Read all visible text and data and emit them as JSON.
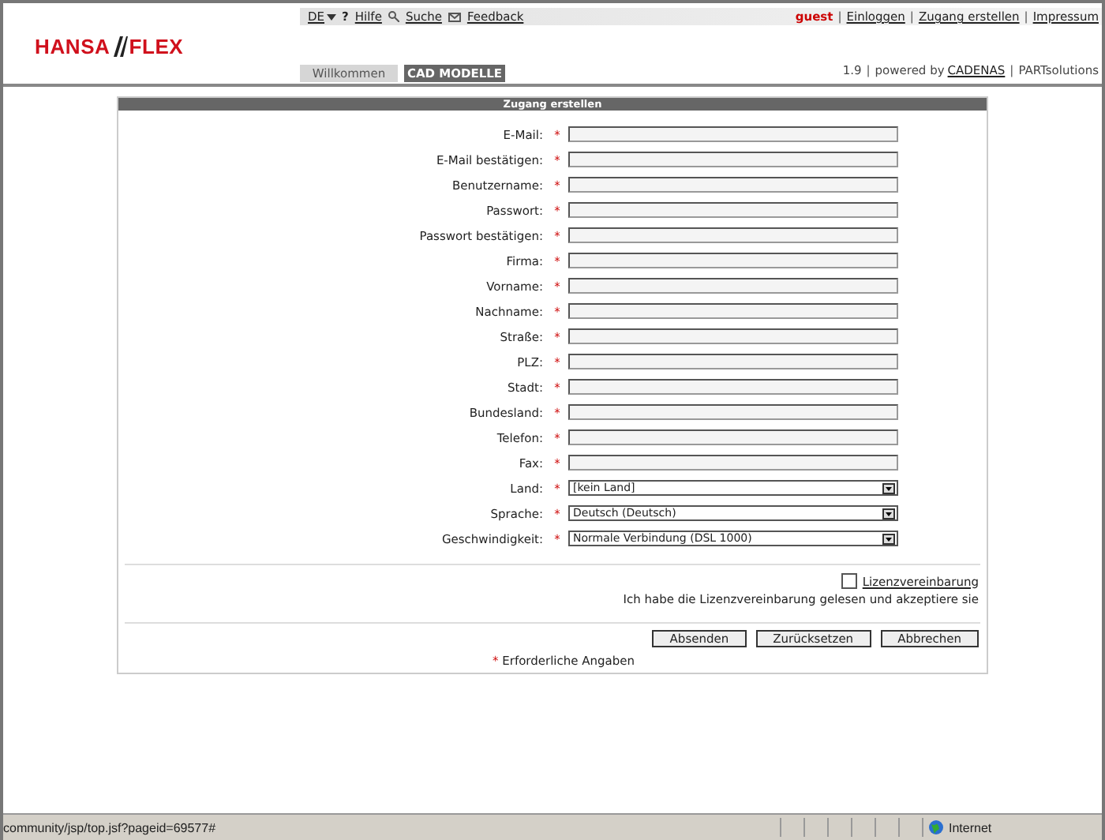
{
  "top_links": {
    "language": "DE",
    "help_mark": "?",
    "items": [
      {
        "label": "Hilfe"
      },
      {
        "label": "Suche"
      },
      {
        "label": "Feedback"
      }
    ]
  },
  "account": {
    "user": "guest",
    "separator": "|",
    "links": [
      "Einloggen",
      "Zugang erstellen",
      "Impressum"
    ]
  },
  "logo": {
    "left": "HANSA",
    "right": "FLEX"
  },
  "tabs": [
    {
      "label": "Willkommen",
      "selected": false
    },
    {
      "label": "CAD MODELLE",
      "selected": true
    }
  ],
  "version": {
    "separator": "|",
    "number": "1.9",
    "powered": "powered by",
    "vendor": "CADENAS",
    "product": "PARTsolutions"
  },
  "form": {
    "title": "Zugang erstellen",
    "fields": [
      {
        "label": "E-Mail:",
        "mark": "*",
        "kind": "text"
      },
      {
        "label": "E-Mail bestätigen:",
        "mark": "*",
        "kind": "text"
      },
      {
        "label": "Benutzername:",
        "mark": "*",
        "kind": "text"
      },
      {
        "label": "Passwort:",
        "mark": "*",
        "kind": "text"
      },
      {
        "label": "Passwort bestätigen:",
        "mark": "*",
        "kind": "text"
      },
      {
        "label": "Firma:",
        "mark": "*",
        "kind": "text"
      },
      {
        "label": "Vorname:",
        "mark": "*",
        "kind": "text"
      },
      {
        "label": "Nachname:",
        "mark": "*",
        "kind": "text"
      },
      {
        "label": "Straße:",
        "mark": "*",
        "kind": "text"
      },
      {
        "label": "PLZ:",
        "mark": "*",
        "kind": "text"
      },
      {
        "label": "Stadt:",
        "mark": "*",
        "kind": "text"
      },
      {
        "label": "Bundesland:",
        "mark": "*",
        "kind": "text"
      },
      {
        "label": "Telefon:",
        "mark": "*",
        "kind": "text"
      },
      {
        "label": "Fax:",
        "mark": "*",
        "kind": "text"
      },
      {
        "label": "Land:",
        "mark": "*",
        "kind": "select",
        "value": "[kein Land]"
      },
      {
        "label": "Sprache:",
        "mark": "*",
        "kind": "select",
        "value": "Deutsch (Deutsch)"
      },
      {
        "label": "Geschwindigkeit:",
        "mark": "*",
        "kind": "select",
        "value": "Normale Verbindung (DSL 1000)"
      }
    ],
    "license": {
      "checked": false,
      "link": "Lizenzvereinbarung",
      "text": "Ich habe die Lizenzvereinbarung gelesen und akzeptiere sie"
    },
    "buttons": [
      "Absenden",
      "Zurücksetzen",
      "Abbrechen"
    ],
    "note": {
      "mark": "*",
      "text": "Erforderliche Angaben"
    }
  },
  "status_bar": {
    "url": "community/jsp/top.jsf?pageid=69577#",
    "zone": "Internet"
  }
}
